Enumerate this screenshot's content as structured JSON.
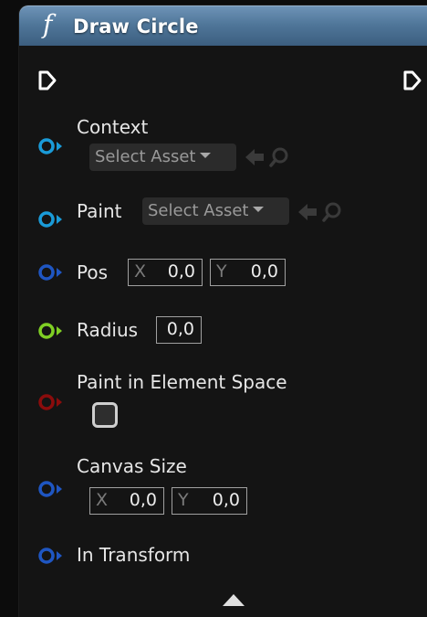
{
  "node": {
    "title": "Draw Circle",
    "function_icon": "f",
    "header_color": "#4f7699"
  },
  "pins": {
    "context": {
      "label": "Context",
      "type_color": "#1a9bd8",
      "dropdown": "Select Asset"
    },
    "paint": {
      "label": "Paint",
      "type_color": "#1a9bd8",
      "dropdown": "Select Asset"
    },
    "pos": {
      "label": "Pos",
      "type_color": "#1f56c2",
      "x_axis": "X",
      "x_value": "0,0",
      "y_axis": "Y",
      "y_value": "0,0"
    },
    "radius": {
      "label": "Radius",
      "type_color": "#7fcf24",
      "value": "0,0"
    },
    "paint_in_element_space": {
      "label": "Paint in Element Space",
      "type_color": "#8b0c0c",
      "checked": false
    },
    "canvas_size": {
      "label": "Canvas Size",
      "type_color": "#1f56c2",
      "x_axis": "X",
      "x_value": "0,0",
      "y_axis": "Y",
      "y_value": "0,0"
    },
    "in_transform": {
      "label": "In Transform",
      "type_color": "#1f56c2"
    }
  },
  "icons": {
    "exec_in": "exec-pin-icon",
    "exec_out": "exec-pin-icon",
    "use_selected": "arrow-left-icon",
    "browse": "search-icon",
    "collapse": "triangle-up-icon"
  }
}
